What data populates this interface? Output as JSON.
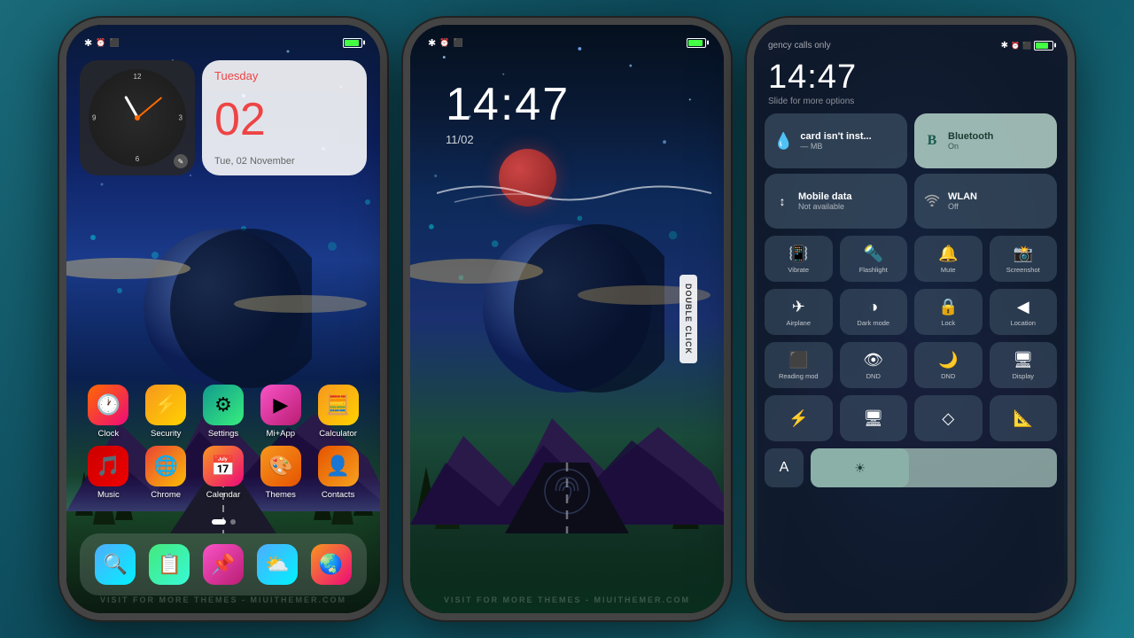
{
  "phone1": {
    "statusBar": {
      "bluetooth": "✱",
      "alarm": "⏰",
      "camera": "📷",
      "battery": ""
    },
    "dateWidget": {
      "dayName": "Tuesday",
      "dateNumber": "02",
      "dateFullText": "Tue, 02 November"
    },
    "apps": {
      "row1": [
        {
          "label": "Clock",
          "icon": "🕐",
          "class": "icon-clock"
        },
        {
          "label": "Security",
          "icon": "⚡",
          "class": "icon-security"
        },
        {
          "label": "Settings",
          "icon": "⚙️",
          "class": "icon-settings"
        },
        {
          "label": "Mi+App",
          "icon": "▶️",
          "class": "icon-mi"
        },
        {
          "label": "Calculator",
          "icon": "🧮",
          "class": "icon-calc"
        }
      ],
      "row2": [
        {
          "label": "Music",
          "icon": "🎵",
          "class": "icon-music"
        },
        {
          "label": "Chrome",
          "icon": "🌐",
          "class": "icon-chrome"
        },
        {
          "label": "Calendar",
          "icon": "📅",
          "class": "icon-calendar"
        },
        {
          "label": "Themes",
          "icon": "🎨",
          "class": "icon-themes"
        },
        {
          "label": "Contacts",
          "icon": "👤",
          "class": "icon-contacts"
        }
      ]
    },
    "dock": [
      {
        "label": "Search",
        "icon": "🔍",
        "class": "icon-search"
      },
      {
        "label": "Notes",
        "icon": "📋",
        "class": "icon-notes"
      },
      {
        "label": "Editor",
        "icon": "📌",
        "class": "icon-editor"
      },
      {
        "label": "Weather",
        "icon": "⛅",
        "class": "icon-weather"
      },
      {
        "label": "Browser",
        "icon": "🌏",
        "class": "icon-browser"
      }
    ],
    "watermark": "VISIT FOR MORE THEMES - MIUITHEMER.COM"
  },
  "phone2": {
    "time": "14:47",
    "date": "11/02",
    "doubleClickText": "DOUBLE CLICK",
    "watermark": "VISIT FOR MORE THEMES - MIUITHEMER.COM"
  },
  "phone3": {
    "statusBarText": "gency calls only",
    "time": "14:47",
    "subtitle": "Slide for more options",
    "tiles": {
      "data": {
        "title": "card isn't inst...",
        "sub": "— MB",
        "icon": "💧",
        "active": false
      },
      "bluetooth": {
        "title": "Bluetooth",
        "sub": "On",
        "icon": "B",
        "active": true
      },
      "mobileData": {
        "title": "Mobile data",
        "sub": "Not available",
        "icon": "↕",
        "active": false
      },
      "wlan": {
        "title": "WLAN",
        "sub": "Off",
        "icon": "wifi",
        "active": false
      }
    },
    "iconButtons": [
      {
        "label": "Vibrate",
        "icon": "📳"
      },
      {
        "label": "Flashlight",
        "icon": "🔦"
      },
      {
        "label": "Mute",
        "icon": "🔔"
      },
      {
        "label": "Screenshot",
        "icon": "📸"
      }
    ],
    "iconButtons2": [
      {
        "label": "Aeroplane",
        "icon": "✈"
      },
      {
        "label": "Dark mode",
        "icon": "◑"
      },
      {
        "label": "Lock",
        "icon": "🔒"
      },
      {
        "label": "Location",
        "icon": "◀"
      }
    ],
    "iconButtons3": [
      {
        "label": "Reading mod",
        "icon": "⬜"
      },
      {
        "label": "DND",
        "icon": "👁"
      },
      {
        "label": "DND",
        "icon": "🌙"
      },
      {
        "label": "Display",
        "icon": "🖥"
      }
    ],
    "iconButtons4": [
      {
        "label": "",
        "icon": "⚡"
      },
      {
        "label": "",
        "icon": "🖥"
      },
      {
        "label": "",
        "icon": "◇"
      },
      {
        "label": "",
        "icon": "📐"
      }
    ],
    "bottomBar": {
      "letter": "A",
      "brightness_icon": "☀"
    }
  }
}
